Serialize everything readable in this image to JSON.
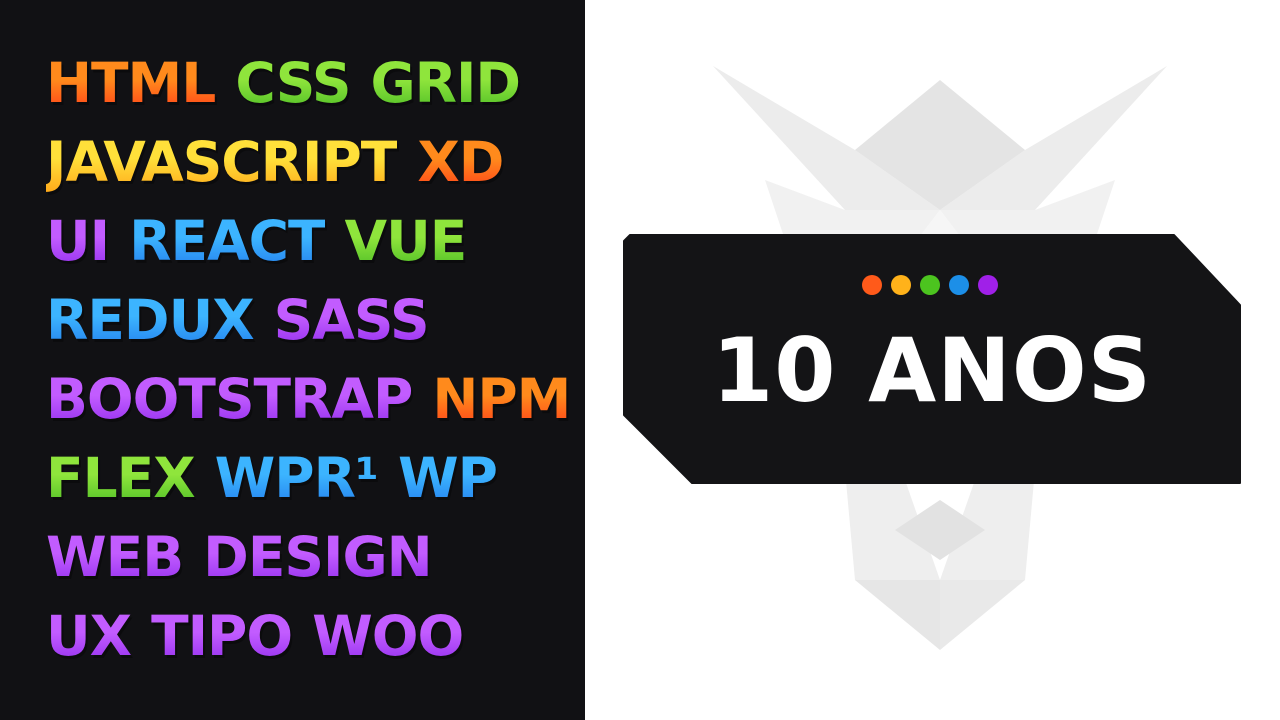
{
  "skills": [
    [
      {
        "text": "HTML",
        "c1": "#ff8a1c",
        "c2": "#ff2a18"
      },
      {
        "text": "CSS",
        "c1": "#8fe53c",
        "c2": "#38b01f"
      },
      {
        "text": "GRID",
        "c1": "#8fe53c",
        "c2": "#38b01f"
      }
    ],
    [
      {
        "text": "JAVASCRIPT",
        "c1": "#ffe03a",
        "c2": "#ff9a12"
      },
      {
        "text": "XD",
        "c1": "#ff8a1c",
        "c2": "#ff2a18"
      }
    ],
    [
      {
        "text": "UI",
        "c1": "#c25cff",
        "c2": "#8420e8"
      },
      {
        "text": "REACT",
        "c1": "#3cb4ff",
        "c2": "#1c6fe8"
      },
      {
        "text": "VUE",
        "c1": "#8fe53c",
        "c2": "#38b01f"
      }
    ],
    [
      {
        "text": "REDUX",
        "c1": "#3cb4ff",
        "c2": "#1c6fe8"
      },
      {
        "text": "SASS",
        "c1": "#c25cff",
        "c2": "#8420e8"
      }
    ],
    [
      {
        "text": "BOOTSTRAP",
        "c1": "#c25cff",
        "c2": "#8420e8"
      },
      {
        "text": "NPM",
        "c1": "#ff8a1c",
        "c2": "#ff2a18"
      }
    ],
    [
      {
        "text": "FLEX",
        "c1": "#8fe53c",
        "c2": "#38b01f"
      },
      {
        "text": "WPR¹",
        "c1": "#3cb4ff",
        "c2": "#1c6fe8"
      },
      {
        "text": "WP",
        "c1": "#3cb4ff",
        "c2": "#1c6fe8"
      }
    ],
    [
      {
        "text": "WEB",
        "c1": "#c25cff",
        "c2": "#8420e8"
      },
      {
        "text": "DESIGN",
        "c1": "#c25cff",
        "c2": "#8420e8"
      }
    ],
    [
      {
        "text": "UX",
        "c1": "#c25cff",
        "c2": "#8420e8"
      },
      {
        "text": "TIPO",
        "c1": "#c25cff",
        "c2": "#8420e8"
      },
      {
        "text": "WOO",
        "c1": "#c25cff",
        "c2": "#8420e8"
      }
    ]
  ],
  "badge": {
    "title": "10 ANOS",
    "dot_colors": [
      "#ff5a1a",
      "#ffb21a",
      "#4cc41f",
      "#1c8fe8",
      "#a020e8"
    ]
  },
  "mascot": {
    "icon": "wolf-mascot-icon"
  }
}
